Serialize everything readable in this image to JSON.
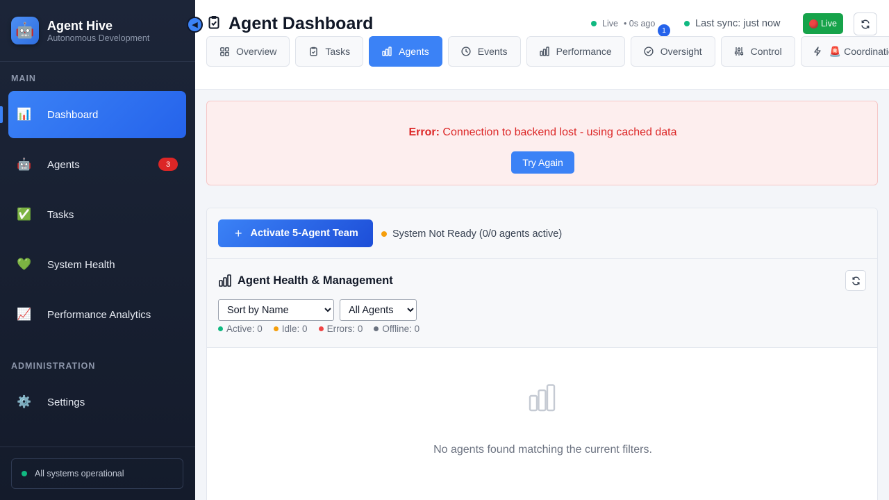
{
  "app": {
    "title": "Agent Hive",
    "subtitle": "Autonomous Development"
  },
  "sidebar": {
    "sections": [
      {
        "label": "MAIN"
      },
      {
        "label": "ADMINISTRATION"
      }
    ],
    "items": [
      {
        "label": "Dashboard",
        "icon": "bar-chart-icon",
        "glyph": "📊",
        "active": true
      },
      {
        "label": "Agents",
        "icon": "robot-icon",
        "glyph": "🤖",
        "badge": "3"
      },
      {
        "label": "Tasks",
        "icon": "check-mark-icon",
        "glyph": "✅"
      },
      {
        "label": "System Health",
        "icon": "green-heart-icon",
        "glyph": "💚"
      },
      {
        "label": "Performance Analytics",
        "icon": "trend-chart-icon",
        "glyph": "📈"
      },
      {
        "label": "Settings",
        "icon": "gear-icon",
        "glyph": "⚙️"
      }
    ],
    "footer_status": "All systems operational"
  },
  "header": {
    "title": "Agent Dashboard",
    "live_label": "Live",
    "live_ago": "• 0s ago",
    "notification_count": "1",
    "sync_label": "Last sync: just now",
    "live_button": "Live"
  },
  "tabs": [
    {
      "label": "Overview",
      "icon": "grid-icon"
    },
    {
      "label": "Tasks",
      "icon": "clipboard-icon"
    },
    {
      "label": "Agents",
      "icon": "bar-chart-icon",
      "active": true
    },
    {
      "label": "Events",
      "icon": "clock-icon"
    },
    {
      "label": "Performance",
      "icon": "bar-chart-icon"
    },
    {
      "label": "Oversight",
      "icon": "check-circle-icon"
    },
    {
      "label": "Control",
      "icon": "sliders-icon"
    },
    {
      "label": "🚨 Coordination",
      "icon": "lightning-icon"
    }
  ],
  "error": {
    "prefix": "Error:",
    "message": "Connection to backend lost - using cached data",
    "retry_label": "Try Again"
  },
  "agents_panel": {
    "activate_label": "Activate 5-Agent Team",
    "readiness": "System Not Ready (0/0 agents active)",
    "title": "Agent Health & Management",
    "sort_selected": "Sort by Name",
    "filter_selected": "All Agents",
    "stats": [
      {
        "label": "Active: 0",
        "color": "#10b981"
      },
      {
        "label": "Idle: 0",
        "color": "#f59e0b"
      },
      {
        "label": "Errors: 0",
        "color": "#ef4444"
      },
      {
        "label": "Offline: 0",
        "color": "#6b7280"
      }
    ],
    "empty_message": "No agents found matching the current filters."
  },
  "colors": {
    "accent": "#3b82f6",
    "sidebar_bg": "#1c2538",
    "error_text": "#dc2626",
    "success": "#16a34a"
  }
}
